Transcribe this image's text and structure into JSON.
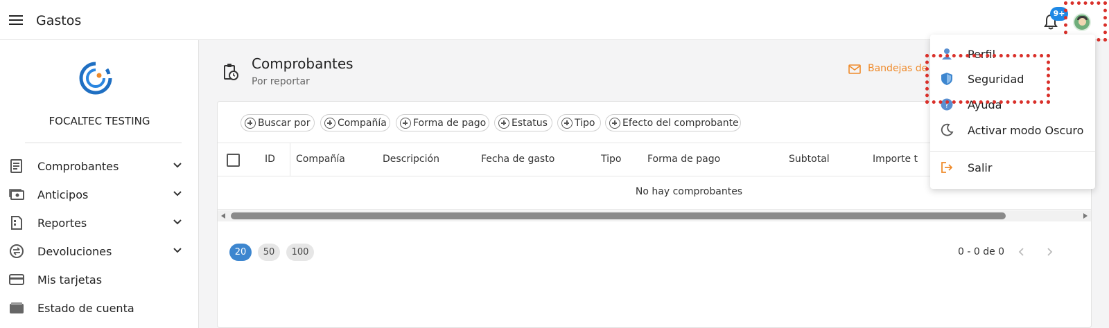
{
  "app": {
    "title": "Gastos",
    "notification_badge": "9+"
  },
  "sidebar": {
    "company": "FOCALTEC TESTING",
    "items": [
      {
        "label": "Comprobantes",
        "icon": "receipt-icon",
        "expandable": true
      },
      {
        "label": "Anticipos",
        "icon": "cash-icon",
        "expandable": true
      },
      {
        "label": "Reportes",
        "icon": "report-icon",
        "expandable": true
      },
      {
        "label": "Devoluciones",
        "icon": "refund-icon",
        "expandable": true
      },
      {
        "label": "Mis tarjetas",
        "icon": "card-icon",
        "expandable": false
      },
      {
        "label": "Estado de cuenta",
        "icon": "wallet-icon",
        "expandable": false
      }
    ]
  },
  "main": {
    "title": "Comprobantes",
    "subtitle": "Por reportar",
    "inbox_link": "Bandejas de"
  },
  "filters": [
    "Buscar por",
    "Compañía",
    "Forma de pago",
    "Estatus",
    "Tipo",
    "Efecto del comprobante"
  ],
  "table": {
    "columns": [
      "ID",
      "Compañía",
      "Descripción",
      "Fecha de gasto",
      "Tipo",
      "Forma de pago",
      "Subtotal",
      "Importe t"
    ],
    "empty_message": "No hay comprobantes"
  },
  "pagination": {
    "page_sizes": [
      "20",
      "50",
      "100"
    ],
    "selected_size": "20",
    "range": "0 - 0 de 0"
  },
  "user_menu": {
    "items": [
      {
        "label": "Perfil",
        "icon": "person-icon"
      },
      {
        "label": "Seguridad",
        "icon": "shield-icon"
      },
      {
        "label": "Ayuda",
        "icon": "help-icon"
      },
      {
        "label": "Activar modo Oscuro",
        "icon": "moon-icon"
      },
      {
        "label": "Salir",
        "icon": "logout-icon"
      }
    ]
  },
  "colors": {
    "accent_blue": "#3d86cf",
    "accent_orange": "#ef8a2a",
    "highlight_red": "#d9302a"
  }
}
